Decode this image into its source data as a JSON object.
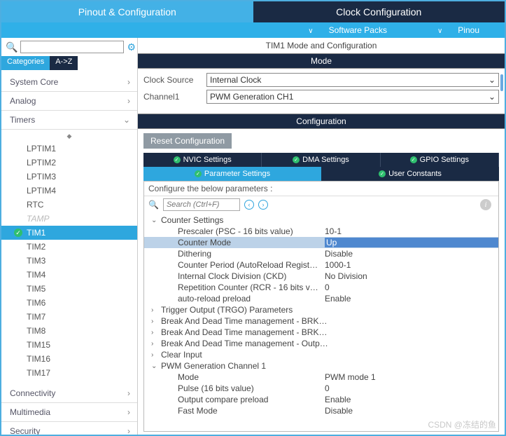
{
  "topbar": {
    "tab1": "Pinout & Configuration",
    "tab2": "Clock Configuration"
  },
  "subbar": {
    "item1": "Software Packs",
    "item2": "Pinou"
  },
  "left": {
    "search_placeholder": "",
    "cat_tabs": {
      "a": "Categories",
      "b": "A->Z"
    },
    "cats": {
      "system": "System Core",
      "analog": "Analog",
      "timers": "Timers",
      "connectivity": "Connectivity",
      "multimedia": "Multimedia",
      "security": "Security"
    },
    "timers": [
      "LPTIM1",
      "LPTIM2",
      "LPTIM3",
      "LPTIM4",
      "RTC",
      "TAMP",
      "TIM1",
      "TIM2",
      "TIM3",
      "TIM4",
      "TIM5",
      "TIM6",
      "TIM7",
      "TIM8",
      "TIM15",
      "TIM16",
      "TIM17"
    ]
  },
  "right": {
    "title": "TIM1 Mode and Configuration",
    "mode_hdr": "Mode",
    "mode": {
      "clock_lbl": "Clock Source",
      "clock_val": "Internal Clock",
      "ch1_lbl": "Channel1",
      "ch1_val": "PWM Generation CH1"
    },
    "config_hdr": "Configuration",
    "reset": "Reset Configuration",
    "tabs1": [
      "NVIC Settings",
      "DMA Settings",
      "GPIO Settings"
    ],
    "tabs2": [
      "Parameter Settings",
      "User Constants"
    ],
    "params_head": "Configure the below parameters :",
    "search2": "Search (Ctrl+F)",
    "groups": {
      "counter": "Counter Settings",
      "trgo": "Trigger Output (TRGO) Parameters",
      "brk1": "Break And Dead Time management - BRK…",
      "brk2": "Break And Dead Time management - BRK…",
      "outp": "Break And Dead Time management - Outp…",
      "clear": "Clear Input",
      "pwm1": "PWM Generation Channel 1"
    },
    "counter_params": [
      {
        "n": "Prescaler (PSC - 16 bits value)",
        "v": "10-1"
      },
      {
        "n": "Counter Mode",
        "v": "Up",
        "sel": true
      },
      {
        "n": "Dithering",
        "v": "Disable"
      },
      {
        "n": "Counter Period (AutoReload Regist…",
        "v": "1000-1"
      },
      {
        "n": "Internal Clock Division (CKD)",
        "v": "No Division"
      },
      {
        "n": "Repetition Counter (RCR - 16 bits v…",
        "v": "0"
      },
      {
        "n": "auto-reload preload",
        "v": "Enable"
      }
    ],
    "pwm_params": [
      {
        "n": "Mode",
        "v": "PWM mode 1"
      },
      {
        "n": "Pulse (16 bits value)",
        "v": "0"
      },
      {
        "n": "Output compare preload",
        "v": "Enable"
      },
      {
        "n": "Fast Mode",
        "v": "Disable"
      }
    ]
  },
  "watermark": "CSDN @冻结的鱼"
}
